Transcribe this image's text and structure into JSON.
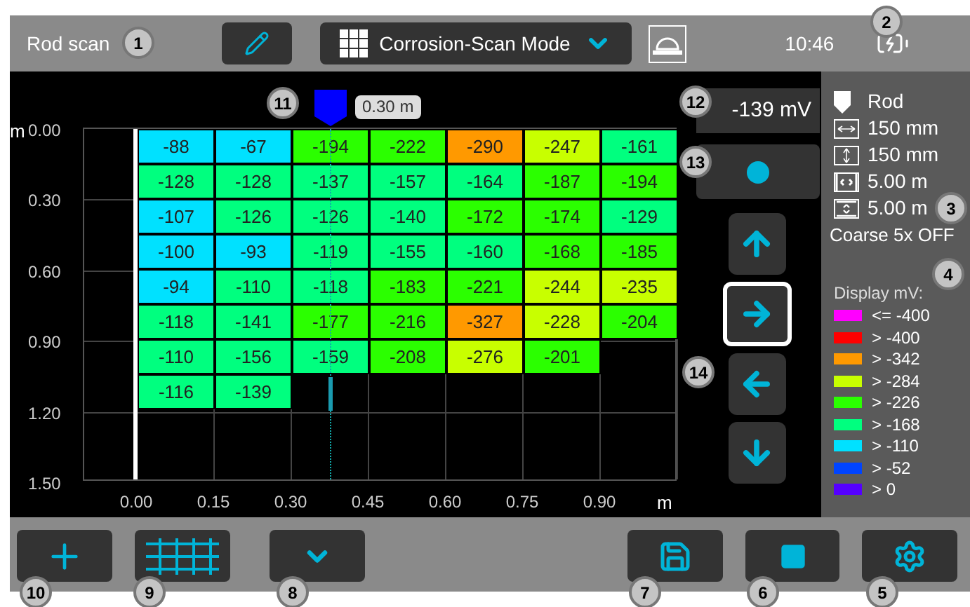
{
  "header": {
    "title": "Rod scan",
    "mode": "Corrosion-Scan Mode",
    "time": "10:46"
  },
  "plot": {
    "marker_label": "0.30 m",
    "y_unit": "m",
    "x_unit": "m",
    "y_ticks": [
      "0.00",
      "0.30",
      "0.60",
      "0.90",
      "1.20",
      "1.50"
    ],
    "x_ticks": [
      "0.00",
      "0.15",
      "0.30",
      "0.45",
      "0.60",
      "0.75",
      "0.90"
    ],
    "rows": [
      [
        {
          "value": "-88",
          "color": "#00e1ff"
        },
        {
          "value": "-67",
          "color": "#00e1ff"
        },
        {
          "value": "-194",
          "color": "#2bff00"
        },
        {
          "value": "-222",
          "color": "#2bff00"
        },
        {
          "value": "-290",
          "color": "#ff9900"
        },
        {
          "value": "-247",
          "color": "#c8ff00"
        },
        {
          "value": "-161",
          "color": "#00ff7f"
        }
      ],
      [
        {
          "value": "-128",
          "color": "#00ff7f"
        },
        {
          "value": "-128",
          "color": "#00ff7f"
        },
        {
          "value": "-137",
          "color": "#00ff7f"
        },
        {
          "value": "-157",
          "color": "#00ff7f"
        },
        {
          "value": "-164",
          "color": "#00ff7f"
        },
        {
          "value": "-187",
          "color": "#2bff00"
        },
        {
          "value": "-194",
          "color": "#2bff00"
        }
      ],
      [
        {
          "value": "-107",
          "color": "#00e1ff"
        },
        {
          "value": "-126",
          "color": "#00ff7f"
        },
        {
          "value": "-126",
          "color": "#00ff7f"
        },
        {
          "value": "-140",
          "color": "#00ff7f"
        },
        {
          "value": "-172",
          "color": "#2bff00"
        },
        {
          "value": "-174",
          "color": "#2bff00"
        },
        {
          "value": "-129",
          "color": "#00ff7f"
        }
      ],
      [
        {
          "value": "-100",
          "color": "#00e1ff"
        },
        {
          "value": "-93",
          "color": "#00e1ff"
        },
        {
          "value": "-119",
          "color": "#00ff7f"
        },
        {
          "value": "-155",
          "color": "#00ff7f"
        },
        {
          "value": "-160",
          "color": "#00ff7f"
        },
        {
          "value": "-168",
          "color": "#2bff00"
        },
        {
          "value": "-185",
          "color": "#2bff00"
        }
      ],
      [
        {
          "value": "-94",
          "color": "#00e1ff"
        },
        {
          "value": "-110",
          "color": "#00ff7f"
        },
        {
          "value": "-118",
          "color": "#00ff7f"
        },
        {
          "value": "-183",
          "color": "#2bff00"
        },
        {
          "value": "-221",
          "color": "#2bff00"
        },
        {
          "value": "-244",
          "color": "#c8ff00"
        },
        {
          "value": "-235",
          "color": "#c8ff00"
        }
      ],
      [
        {
          "value": "-118",
          "color": "#00ff7f"
        },
        {
          "value": "-141",
          "color": "#00ff7f"
        },
        {
          "value": "-177",
          "color": "#2bff00"
        },
        {
          "value": "-216",
          "color": "#2bff00"
        },
        {
          "value": "-327",
          "color": "#ff9900"
        },
        {
          "value": "-228",
          "color": "#c8ff00"
        },
        {
          "value": "-204",
          "color": "#2bff00"
        }
      ],
      [
        {
          "value": "-110",
          "color": "#00ff7f"
        },
        {
          "value": "-156",
          "color": "#00ff7f"
        },
        {
          "value": "-159",
          "color": "#00ff7f"
        },
        {
          "value": "-208",
          "color": "#2bff00"
        },
        {
          "value": "-276",
          "color": "#c8ff00"
        },
        {
          "value": "-201",
          "color": "#2bff00"
        }
      ],
      [
        {
          "value": "-116",
          "color": "#00ff7f"
        },
        {
          "value": "-139",
          "color": "#00ff7f"
        }
      ]
    ]
  },
  "readout": "-139 mV",
  "nav_buttons": [
    {
      "kind": "up",
      "selected": false
    },
    {
      "kind": "right",
      "selected": true
    },
    {
      "kind": "left",
      "selected": false
    },
    {
      "kind": "down",
      "selected": false
    }
  ],
  "info": {
    "probe": "Rod",
    "items": [
      {
        "kind": "width",
        "text": "150 mm"
      },
      {
        "kind": "height",
        "text": "150 mm"
      },
      {
        "kind": "length",
        "text": "5.00 m"
      },
      {
        "kind": "depth",
        "text": "5.00 m"
      }
    ],
    "coarse": "Coarse 5x OFF"
  },
  "legend": {
    "title": "Display mV:",
    "items": [
      {
        "label": "<= -400",
        "color": "#ff00ff"
      },
      {
        "label": "> -400",
        "color": "#ff0000"
      },
      {
        "label": "> -342",
        "color": "#ff9900"
      },
      {
        "label": "> -284",
        "color": "#c8ff00"
      },
      {
        "label": "> -226",
        "color": "#2bff00"
      },
      {
        "label": "> -168",
        "color": "#00ff7f"
      },
      {
        "label": "> -110",
        "color": "#00e1ff"
      },
      {
        "label": "> -52",
        "color": "#0044ff"
      },
      {
        "label": "> 0",
        "color": "#5500ff"
      }
    ]
  },
  "callouts": [
    "2",
    "1",
    "11",
    "12",
    "13",
    "3",
    "4",
    "14",
    "10",
    "9",
    "8",
    "7",
    "6",
    "5"
  ]
}
